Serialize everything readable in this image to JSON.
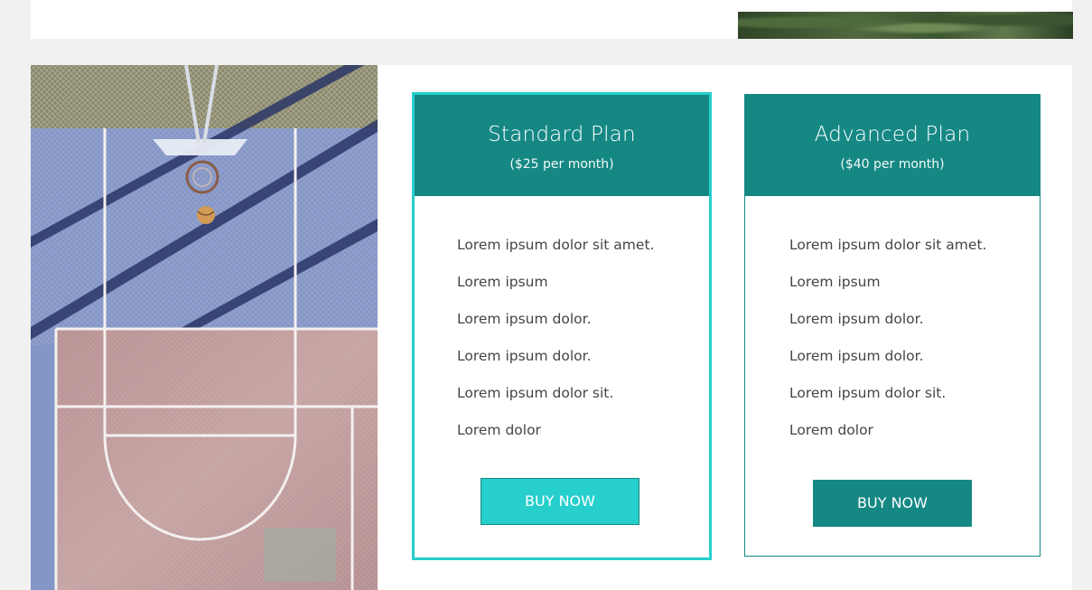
{
  "plans": [
    {
      "name": "Standard Plan",
      "price": "($25 per month)",
      "features": [
        "Lorem ipsum dolor sit amet.",
        "Lorem ipsum",
        "Lorem ipsum dolor.",
        "Lorem ipsum dolor.",
        "Lorem ipsum dolor sit.",
        "Lorem dolor"
      ],
      "button_label": "BUY NOW"
    },
    {
      "name": "Advanced Plan",
      "price": "($40 per month)",
      "features": [
        "Lorem ipsum dolor sit amet.",
        "Lorem ipsum",
        "Lorem ipsum dolor.",
        "Lorem ipsum dolor.",
        "Lorem ipsum dolor sit.",
        "Lorem dolor"
      ],
      "button_label": "BUY NOW"
    }
  ],
  "colors": {
    "header_teal": "#158884",
    "highlight_cyan": "#26cfcc",
    "page_background": "#f1f1f1",
    "text": "#444444"
  }
}
